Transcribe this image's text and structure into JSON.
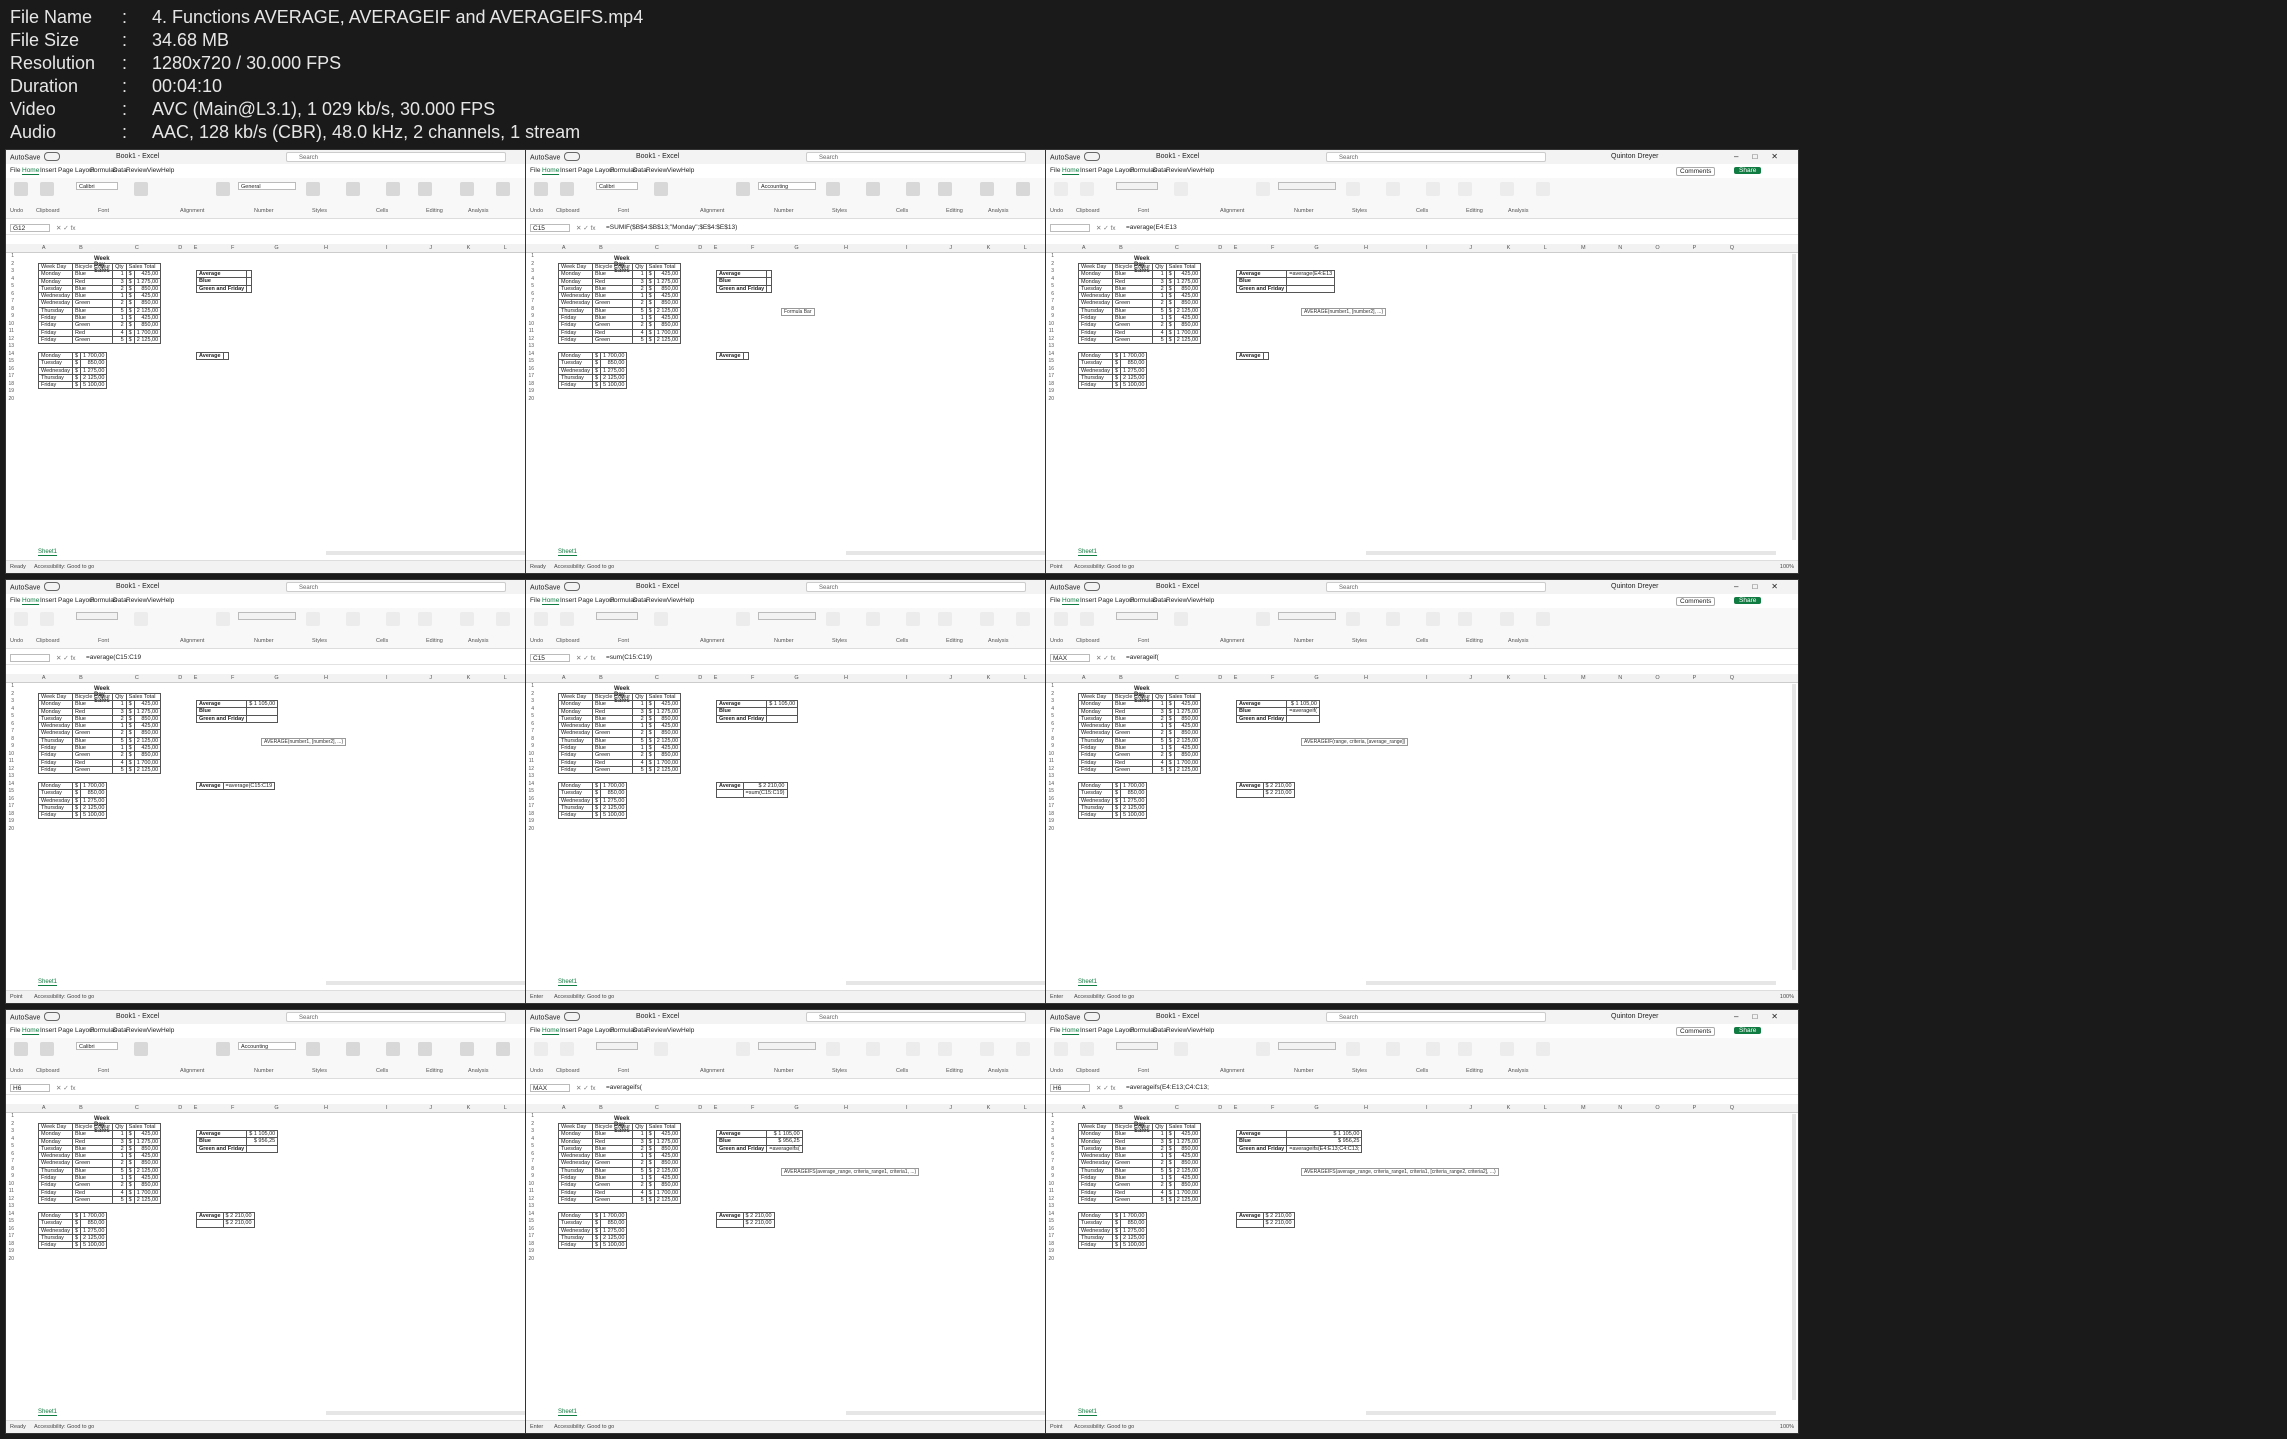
{
  "media_info": [
    {
      "key": "File Name",
      "value": "4. Functions AVERAGE, AVERAGEIF and AVERAGEIFS.mp4"
    },
    {
      "key": "File Size",
      "value": "34.68 MB"
    },
    {
      "key": "Resolution",
      "value": "1280x720 / 30.000 FPS"
    },
    {
      "key": "Duration",
      "value": "00:04:10"
    },
    {
      "key": "Video",
      "value": "AVC (Main@L3.1), 1 029 kb/s, 30.000 FPS"
    },
    {
      "key": "Audio",
      "value": "AAC, 128 kb/s (CBR), 48.0 kHz, 2 channels, 1 stream"
    }
  ],
  "excel": {
    "autosave": "AutoSave",
    "toggle": "Off",
    "book": "Book1 - Excel",
    "search": "Search",
    "user": "Quinton Dreyer",
    "tabs": [
      "File",
      "Home",
      "Insert",
      "Page Layout",
      "Formulas",
      "Data",
      "Review",
      "View",
      "Help"
    ],
    "comments": "Comments",
    "share": "Share",
    "groups": [
      "Undo",
      "Clipboard",
      "Font",
      "Alignment",
      "Number",
      "Styles",
      "Cells",
      "Editing",
      "Analysis"
    ],
    "columns": [
      "A",
      "B",
      "C",
      "D",
      "E",
      "F",
      "G",
      "H",
      "I",
      "J",
      "K",
      "L",
      "M",
      "N",
      "O",
      "P",
      "Q"
    ],
    "sheet_tab": "Sheet1",
    "accessibility": "Accessibility: Good to go",
    "zoom": "100%",
    "table_title": "Week Day Sales",
    "headers": [
      "Week Day",
      "Bicycle Colour",
      "Qty",
      "Sales Total"
    ],
    "rows": [
      [
        "Monday",
        "Blue",
        "1",
        "$",
        "425,00"
      ],
      [
        "Monday",
        "Red",
        "3",
        "$",
        "1 275,00"
      ],
      [
        "Tuesday",
        "Blue",
        "2",
        "$",
        "850,00"
      ],
      [
        "Wednesday",
        "Blue",
        "1",
        "$",
        "425,00"
      ],
      [
        "Wednesday",
        "Green",
        "2",
        "$",
        "850,00"
      ],
      [
        "Thursday",
        "Blue",
        "5",
        "$",
        "2 125,00"
      ],
      [
        "Friday",
        "Blue",
        "1",
        "$",
        "425,00"
      ],
      [
        "Friday",
        "Green",
        "2",
        "$",
        "850,00"
      ],
      [
        "Friday",
        "Red",
        "4",
        "$",
        "1 700,00"
      ],
      [
        "Friday",
        "Green",
        "5",
        "$",
        "2 125,00"
      ]
    ],
    "daily": [
      [
        "Monday",
        "$",
        "1 700,00"
      ],
      [
        "Tuesday",
        "$",
        "850,00"
      ],
      [
        "Wednesday",
        "$",
        "1 275,00"
      ],
      [
        "Thursday",
        "$",
        "2 125,00"
      ],
      [
        "Friday",
        "$",
        "5 100,00"
      ]
    ],
    "summary_labels": [
      "Average",
      "Blue",
      "Green and Friday"
    ],
    "average_label": "Average"
  },
  "frames": [
    {
      "namebox": "G12",
      "formula": "",
      "status": "Ready",
      "font": "Calibri",
      "numfmt": "General",
      "dim": false,
      "avg": "",
      "blue": "",
      "green": "",
      "avg2": "",
      "avg2b": "",
      "tip": ""
    },
    {
      "namebox": "C15",
      "formula": "=SUMIF($B$4:$B$13;\"Monday\";$E$4:$E$13)",
      "status": "Ready",
      "font": "Calibri",
      "numfmt": "Accounting",
      "dim": false,
      "avg": "",
      "blue": "",
      "green": "",
      "avg2": "",
      "avg2b": "",
      "tip": "Formula Bar"
    },
    {
      "namebox": "",
      "formula": "=average(E4:E13",
      "status": "Point",
      "font": "",
      "numfmt": "",
      "dim": true,
      "avg": "=average(E4:E13",
      "blue": "",
      "green": "",
      "avg2": "",
      "avg2b": "",
      "tip": "AVERAGE(number1, [number2], ...)"
    },
    {
      "namebox": "",
      "formula": "=average(C15:C19",
      "status": "Point",
      "font": "",
      "numfmt": "",
      "dim": true,
      "avg": "$ 1 105,00",
      "blue": "",
      "green": "",
      "avg2": "=average(C15:C19",
      "avg2b": "",
      "tip": "AVERAGE(number1, [number2], ...)"
    },
    {
      "namebox": "C15",
      "formula": "=sum(C15:C19)",
      "status": "Enter",
      "font": "",
      "numfmt": "",
      "dim": true,
      "avg": "$ 1 105,00",
      "blue": "",
      "green": "",
      "avg2": "$ 2 210,00",
      "avg2b": "=sum(C15:C19)",
      "tip": ""
    },
    {
      "namebox": "MAX",
      "formula": "=averageif(",
      "status": "Enter",
      "font": "",
      "numfmt": "",
      "dim": true,
      "avg": "$ 1 105,00",
      "blue": "=averageif(",
      "green": "",
      "avg2": "$ 2 210,00",
      "avg2b": "$ 2 210,00",
      "tip": "AVERAGEIF(range, criteria, [average_range])"
    },
    {
      "namebox": "H6",
      "formula": "",
      "status": "Ready",
      "font": "Calibri",
      "numfmt": "Accounting",
      "dim": false,
      "avg": "$ 1 105,00",
      "blue": "$ 956,25",
      "green": "",
      "avg2": "$ 2 210,00",
      "avg2b": "$ 2 210,00",
      "tip": ""
    },
    {
      "namebox": "MAX",
      "formula": "=averageifs(",
      "status": "Enter",
      "font": "",
      "numfmt": "",
      "dim": true,
      "avg": "$ 1 105,00",
      "blue": "$ 956,25",
      "green": "=averageifs(",
      "avg2": "$ 2 210,00",
      "avg2b": "$ 2 210,00",
      "tip": "AVERAGEIFS(average_range, criteria_range1, criteria1, ...)"
    },
    {
      "namebox": "H6",
      "formula": "=averageifs(E4:E13;C4:C13;",
      "status": "Point",
      "font": "",
      "numfmt": "",
      "dim": true,
      "avg": "$ 1 105,00",
      "blue": "$ 956,25",
      "green": "=averageifs(E4:E13;C4:C13;",
      "avg2": "$ 2 210,00",
      "avg2b": "$ 2 210,00",
      "tip": "AVERAGEIFS(average_range, criteria_range1, criteria1, [criteria_range2, criteria2], ...)"
    }
  ]
}
